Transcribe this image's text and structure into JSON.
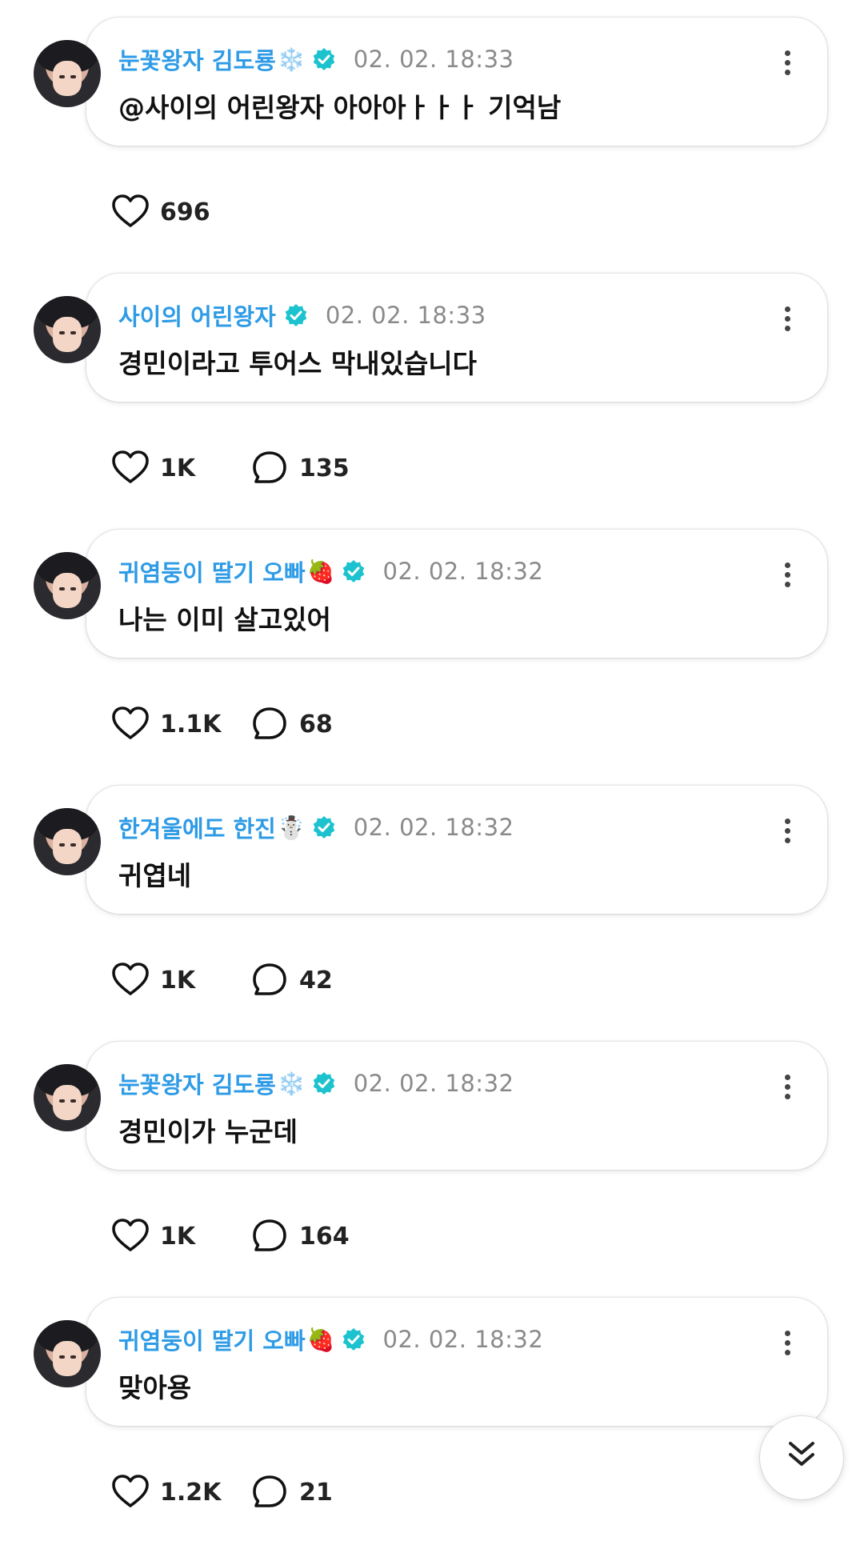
{
  "colors": {
    "name": "#2e9be6",
    "verified": "#1cc3cf",
    "time": "#8a8a8a"
  },
  "comments": [
    {
      "name": "눈꽃왕자 김도룡",
      "emoji": "❄️",
      "time": "02. 02. 18:33",
      "text": "@사이의 어린왕자 아아아ㅏㅏㅏ 기억남",
      "likes": "696",
      "replies": ""
    },
    {
      "name": "사이의 어린왕자",
      "emoji": "",
      "time": "02. 02. 18:33",
      "text": "경민이라고 투어스 막내있습니다",
      "likes": "1K",
      "replies": "135"
    },
    {
      "name": "귀염둥이 딸기 오빠",
      "emoji": "🍓",
      "time": "02. 02. 18:32",
      "text": "나는 이미 살고있어",
      "likes": "1.1K",
      "replies": "68"
    },
    {
      "name": "한겨울에도 한진",
      "emoji": "☃️",
      "time": "02. 02. 18:32",
      "text": "귀엽네",
      "likes": "1K",
      "replies": "42"
    },
    {
      "name": "눈꽃왕자 김도룡",
      "emoji": "❄️",
      "time": "02. 02. 18:32",
      "text": "경민이가 누군데",
      "likes": "1K",
      "replies": "164"
    },
    {
      "name": "귀염둥이 딸기 오빠",
      "emoji": "🍓",
      "time": "02. 02. 18:32",
      "text": "맞아용",
      "likes": "1.2K",
      "replies": "21"
    }
  ],
  "icons": {
    "like": "heart-icon",
    "reply": "speech-bubble-icon",
    "more": "more-vertical-icon",
    "verified": "verified-badge-icon",
    "scroll": "chevron-double-down-icon"
  }
}
